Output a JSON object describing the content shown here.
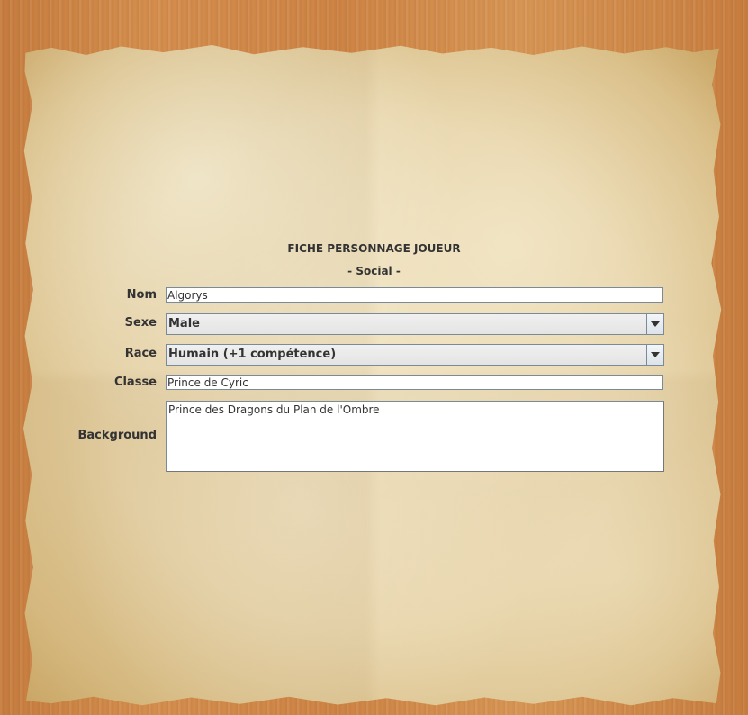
{
  "header": {
    "title": "FICHE PERSONNAGE JOUEUR",
    "subtitle": "- Social -"
  },
  "form": {
    "nom": {
      "label": "Nom",
      "value": "Algorys"
    },
    "sexe": {
      "label": "Sexe",
      "selected": "Male"
    },
    "race": {
      "label": "Race",
      "selected": "Humain (+1 compétence)"
    },
    "classe": {
      "label": "Classe",
      "value": "Prince de Cyric"
    },
    "background": {
      "label": "Background",
      "value": "Prince des Dragons du Plan de l'Ombre"
    }
  },
  "icons": {
    "dropdown": "chevron-down-icon"
  },
  "colors": {
    "wood": "#d08849",
    "parchment": "#e8d6ac",
    "text": "#333333",
    "field_border": "#7a8a99"
  }
}
